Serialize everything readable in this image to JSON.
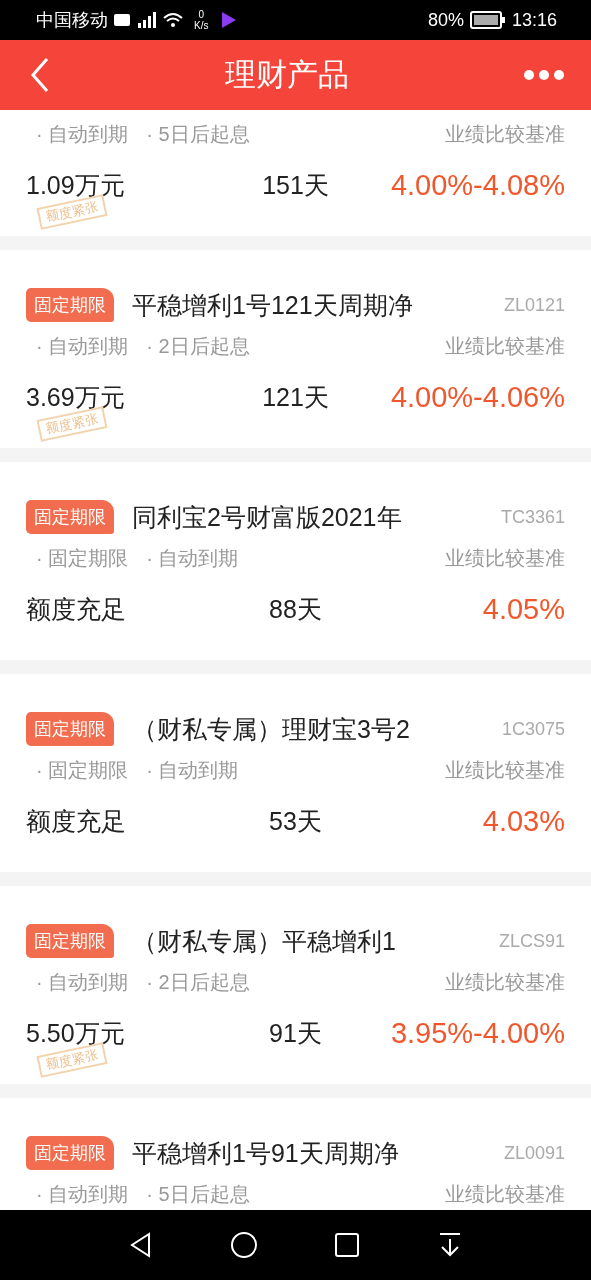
{
  "status_bar": {
    "carrier": "中国移动",
    "speed_value": "0",
    "speed_unit": "K/s",
    "battery": "80%",
    "time": "13:16"
  },
  "header": {
    "title": "理财产品"
  },
  "products": [
    {
      "features": [
        "· 自动到期",
        "· 5日后起息"
      ],
      "benchmark_label": "业绩比较基准",
      "amount": "1.09万元",
      "term": "151天",
      "rate": "4.00%-4.08%",
      "stamp": "额度紧张"
    },
    {
      "tag": "固定期限",
      "title": "平稳增利1号121天周期净",
      "code": "ZL0121",
      "features": [
        "· 自动到期",
        "· 2日后起息"
      ],
      "benchmark_label": "业绩比较基准",
      "amount": "3.69万元",
      "term": "121天",
      "rate": "4.00%-4.06%",
      "stamp": "额度紧张"
    },
    {
      "tag": "固定期限",
      "title": "同利宝2号财富版2021年",
      "code": "TC3361",
      "features": [
        "· 固定期限",
        "· 自动到期"
      ],
      "benchmark_label": "业绩比较基准",
      "amount": "额度充足",
      "term": "88天",
      "rate": "4.05%"
    },
    {
      "tag": "固定期限",
      "title": "（财私专属）理财宝3号2",
      "code": "1C3075",
      "features": [
        "· 固定期限",
        "· 自动到期"
      ],
      "benchmark_label": "业绩比较基准",
      "amount": "额度充足",
      "term": "53天",
      "rate": "4.03%"
    },
    {
      "tag": "固定期限",
      "title": "（财私专属）平稳增利1",
      "code": "ZLCS91",
      "features": [
        "· 自动到期",
        "· 2日后起息"
      ],
      "benchmark_label": "业绩比较基准",
      "amount": "5.50万元",
      "term": "91天",
      "rate": "3.95%-4.00%",
      "stamp": "额度紧张"
    },
    {
      "tag": "固定期限",
      "title": "平稳增利1号91天周期净",
      "code": "ZL0091",
      "features": [
        "· 自动到期",
        "· 5日后起息"
      ],
      "benchmark_label": "业绩比较基准"
    }
  ]
}
